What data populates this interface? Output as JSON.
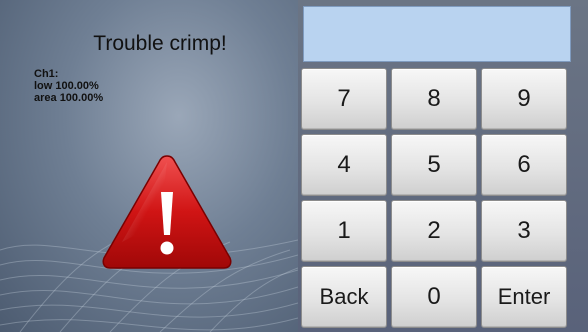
{
  "alert": {
    "title": "Trouble crimp!",
    "channel_label": "Ch1:",
    "low_line": "low 100.00%",
    "area_line": "area 100.00%",
    "icon": "warning-triangle-icon",
    "icon_color": "#d01414"
  },
  "numeric_display": {
    "value": ""
  },
  "keypad": {
    "key_7": "7",
    "key_8": "8",
    "key_9": "9",
    "key_4": "4",
    "key_5": "5",
    "key_6": "6",
    "key_1": "1",
    "key_2": "2",
    "key_3": "3",
    "back": "Back",
    "key_0": "0",
    "enter": "Enter"
  },
  "colors": {
    "display_background": "#b9d3f0",
    "key_background": "#e4e4e4"
  }
}
